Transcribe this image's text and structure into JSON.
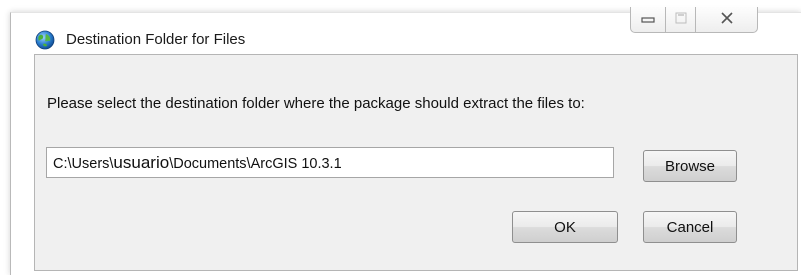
{
  "window": {
    "title": "Destination Folder for Files",
    "icon": "globe-icon",
    "controls": [
      "minimize-icon",
      "maximize-icon",
      "close-icon"
    ]
  },
  "dialog": {
    "instruction": "Please select the destination folder where the package should extract the files to:",
    "path": {
      "prefix": "C:\\Users\\",
      "user": "usuario",
      "suffix": "\\Documents\\ArcGIS 10.3.1"
    },
    "browse_label": "Browse",
    "ok_label": "OK",
    "cancel_label": "Cancel"
  }
}
